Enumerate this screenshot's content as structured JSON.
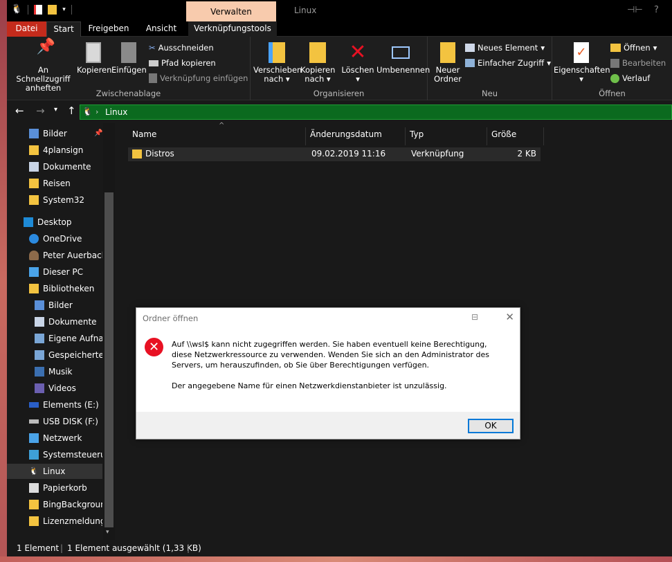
{
  "window": {
    "title": "Linux",
    "context_tab": "Verwalten"
  },
  "ribbon_tabs": [
    "Datei",
    "Start",
    "Freigeben",
    "Ansicht",
    "Verknüpfungstools"
  ],
  "groups": {
    "clipboard": {
      "label": "Zwischenablage",
      "pin": "An Schnellzugriff anheften",
      "copy": "Kopieren",
      "paste": "Einfügen",
      "cut": "Ausschneiden",
      "copy_path": "Pfad kopieren",
      "paste_link": "Verknüpfung einfügen"
    },
    "organize": {
      "label": "Organisieren",
      "move_1": "Verschieben",
      "move_2": "nach",
      "copy_1": "Kopieren",
      "copy_2": "nach",
      "delete": "Löschen",
      "rename": "Umbenennen"
    },
    "new": {
      "label": "Neu",
      "folder_1": "Neuer",
      "folder_2": "Ordner",
      "new_item": "Neues Element",
      "easy_access": "Einfacher Zugriff"
    },
    "open": {
      "label": "Öffnen",
      "properties": "Eigenschaften",
      "open": "Öffnen",
      "edit": "Bearbeiten",
      "history": "Verlauf"
    }
  },
  "address": {
    "crumb": "Linux"
  },
  "sidebar": [
    {
      "label": "Bilder",
      "icon": "pictures-icon"
    },
    {
      "label": "4plansign",
      "icon": "folder-icon"
    },
    {
      "label": "Dokumente",
      "icon": "documents-icon"
    },
    {
      "label": "Reisen",
      "icon": "folder-icon"
    },
    {
      "label": "System32",
      "icon": "folder-icon"
    },
    {
      "label": "Desktop",
      "icon": "desktop-icon"
    },
    {
      "label": "OneDrive",
      "icon": "onedrive-icon"
    },
    {
      "label": "Peter Auerbacher",
      "icon": "user-icon"
    },
    {
      "label": "Dieser PC",
      "icon": "pc-icon"
    },
    {
      "label": "Bibliotheken",
      "icon": "libraries-icon"
    },
    {
      "label": "Bilder",
      "icon": "pictures-icon"
    },
    {
      "label": "Dokumente",
      "icon": "documents-icon"
    },
    {
      "label": "Eigene Aufnahmen",
      "icon": "recordings-icon"
    },
    {
      "label": "Gespeicherte Bilder",
      "icon": "pictures-icon"
    },
    {
      "label": "Musik",
      "icon": "music-icon"
    },
    {
      "label": "Videos",
      "icon": "videos-icon"
    },
    {
      "label": "Elements (E:)",
      "icon": "drive-icon"
    },
    {
      "label": "USB DISK (F:)",
      "icon": "usb-icon"
    },
    {
      "label": "Netzwerk",
      "icon": "network-icon"
    },
    {
      "label": "Systemsteuerung",
      "icon": "control-panel-icon"
    },
    {
      "label": "Linux",
      "icon": "linux-icon"
    },
    {
      "label": "Papierkorb",
      "icon": "recycle-bin-icon"
    },
    {
      "label": "BingBackground",
      "icon": "folder-icon"
    },
    {
      "label": "Lizenzmeldungen",
      "icon": "folder-icon"
    }
  ],
  "columns": {
    "name": "Name",
    "date": "Änderungsdatum",
    "type": "Typ",
    "size": "Größe"
  },
  "files": [
    {
      "name": "Distros",
      "date": "09.02.2019 11:16",
      "type": "Verknüpfung",
      "size": "2 KB"
    }
  ],
  "status": {
    "count": "1 Element",
    "selected": "1 Element ausgewählt (1,33 KB)"
  },
  "dialog": {
    "title": "Ordner öffnen",
    "message": "Auf \\\\wsl$ kann nicht zugegriffen werden. Sie haben eventuell keine Berechtigung, diese Netzwerkressource zu verwenden. Wenden Sie sich an den Administrator des Servers, um herauszufinden, ob Sie über Berechtigungen verfügen.",
    "detail": "Der angegebene Name für einen Netzwerkdienstanbieter ist unzulässig.",
    "ok": "OK"
  },
  "colors": {
    "accent_green": "#0b6a1f",
    "error_red": "#e81123",
    "file_tab": "#c42b1c",
    "context_tab": "#f8cbad"
  }
}
